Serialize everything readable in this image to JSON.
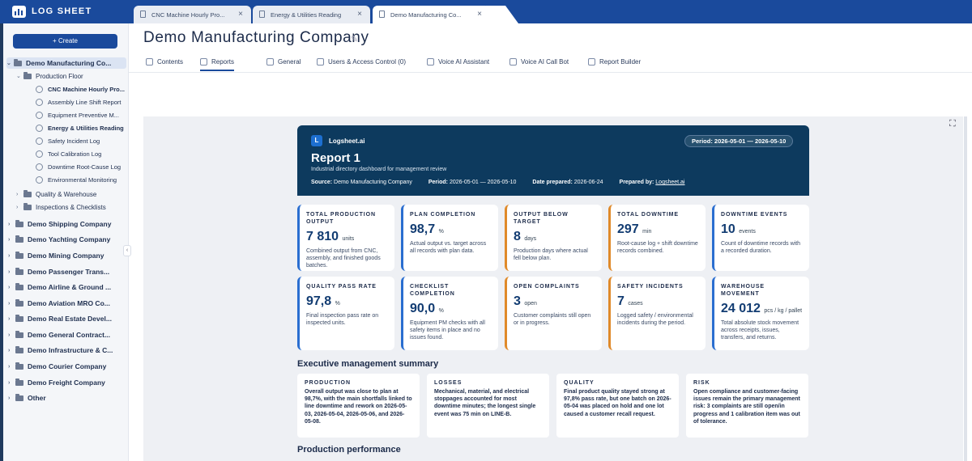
{
  "app": {
    "brand": "LOG SHEET"
  },
  "tabs": [
    {
      "label": "CNC Machine Hourly Pro..."
    },
    {
      "label": "Energy & Utilities Reading"
    },
    {
      "label": "Demo Manufacturing Co..."
    }
  ],
  "sidebar": {
    "create_label": "Create",
    "company": "Demo Manufacturing Co...",
    "group": "Production Floor",
    "docs": [
      "CNC Machine Hourly Pro...",
      "Assembly Line Shift Report",
      "Equipment Preventive M...",
      "Energy & Utilities Reading",
      "Safety Incident Log",
      "Tool Calibration Log",
      "Downtime Root-Cause Log",
      "Environmental Monitoring"
    ],
    "subgroups": [
      "Quality & Warehouse",
      "Inspections & Checklists"
    ],
    "companies": [
      "Demo Shipping Company",
      "Demo Yachting Company",
      "Demo Mining Company",
      "Demo Passenger Trans...",
      "Demo Airline & Ground ...",
      "Demo Aviation MRO Co...",
      "Demo Real Estate Devel...",
      "Demo General Contract...",
      "Demo Infrastructure & C...",
      "Demo Courier Company",
      "Demo Freight Company",
      "Other"
    ]
  },
  "page": {
    "title": "Demo Manufacturing Company",
    "subnav": [
      "Contents",
      "Reports",
      "General",
      "Users & Access Control (0)",
      "Voice AI Assistant",
      "Voice AI Call Bot",
      "Report Builder"
    ]
  },
  "report": {
    "brand": "Logsheet.ai",
    "logo_letter": "L",
    "period_badge": "Period: 2026-05-01 — 2026-05-10",
    "title": "Report 1",
    "subtitle": "Industrial directory dashboard for management review",
    "source_label": "Source:",
    "source": "Demo Manufacturing Company",
    "period_label": "Period:",
    "period": "2026-05-01 — 2026-05-10",
    "date_label": "Date prepared:",
    "date": "2026-06-24",
    "by_label": "Prepared by:",
    "by": "Logsheet.ai",
    "cards": [
      {
        "title": "TOTAL PRODUCTION OUTPUT",
        "value": "7 810",
        "unit": "units",
        "desc": "Combined output from CNC, assembly, and finished goods batches.",
        "color": "#2a6ed0"
      },
      {
        "title": "PLAN COMPLETION",
        "value": "98,7",
        "unit": "%",
        "desc": "Actual output vs. target across all records with plan data.",
        "color": "#2a6ed0"
      },
      {
        "title": "OUTPUT BELOW TARGET",
        "value": "8",
        "unit": "days",
        "desc": "Production days where actual fell below plan.",
        "color": "#e08a2a"
      },
      {
        "title": "TOTAL DOWNTIME",
        "value": "297",
        "unit": "min",
        "desc": "Root-cause log + shift downtime records combined.",
        "color": "#e08a2a"
      },
      {
        "title": "DOWNTIME EVENTS",
        "value": "10",
        "unit": "events",
        "desc": "Count of downtime records with a recorded duration.",
        "color": "#2a6ed0"
      },
      {
        "title": "QUALITY PASS RATE",
        "value": "97,8",
        "unit": "%",
        "desc": "Final inspection pass rate on inspected units.",
        "color": "#2a6ed0"
      },
      {
        "title": "CHECKLIST COMPLETION",
        "value": "90,0",
        "unit": "%",
        "desc": "Equipment PM checks with all safety items in place and no issues found.",
        "color": "#2a6ed0"
      },
      {
        "title": "OPEN COMPLAINTS",
        "value": "3",
        "unit": "open",
        "desc": "Customer complaints still open or in progress.",
        "color": "#e08a2a"
      },
      {
        "title": "SAFETY INCIDENTS",
        "value": "7",
        "unit": "cases",
        "desc": "Logged safety / environmental incidents during the period.",
        "color": "#e08a2a"
      },
      {
        "title": "WAREHOUSE MOVEMENT",
        "value": "24 012",
        "unit": "pcs / kg / pallet",
        "desc": "Total absolute stock movement across receipts, issues, transfers, and returns.",
        "color": "#2a6ed0"
      }
    ],
    "exec_title": "Executive management summary",
    "summary": [
      {
        "title": "PRODUCTION",
        "text": "Overall output was close to plan at 98,7%, with the main shortfalls linked to line downtime and rework on 2026-05-03, 2026-05-04, 2026-05-06, and 2026-05-08."
      },
      {
        "title": "LOSSES",
        "text": "Mechanical, material, and electrical stoppages accounted for most downtime minutes; the longest single event was 75 min on LINE-B."
      },
      {
        "title": "QUALITY",
        "text": "Final product quality stayed strong at 97,8% pass rate, but one batch on 2026-05-04 was placed on hold and one lot caused a customer recall request."
      },
      {
        "title": "RISK",
        "text": "Open compliance and customer-facing issues remain the primary management risk: 3 complaints are still open/in progress and 1 calibration item was out of tolerance."
      }
    ],
    "perf_title": "Production performance"
  }
}
